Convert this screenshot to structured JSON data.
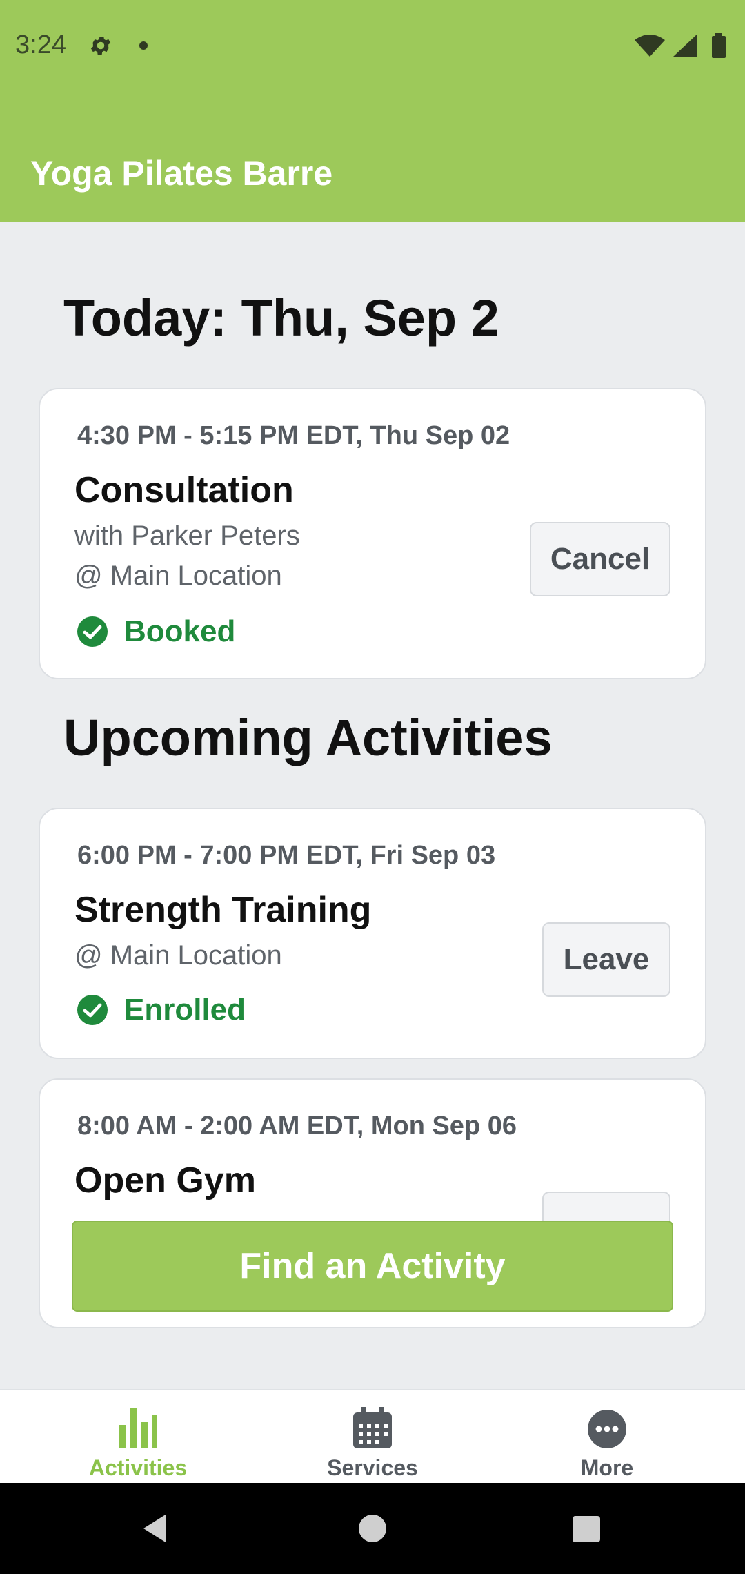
{
  "status_bar": {
    "time": "3:24"
  },
  "header": {
    "title": "Yoga Pilates Barre"
  },
  "today": {
    "heading": "Today: Thu, Sep 2",
    "card": {
      "time": "4:30 PM - 5:15 PM EDT, Thu Sep 02",
      "name": "Consultation",
      "instructor": "with Parker Peters",
      "location": "@ Main Location",
      "status": "Booked",
      "action": "Cancel"
    }
  },
  "upcoming": {
    "heading": "Upcoming Activities",
    "items": [
      {
        "time": "6:00 PM - 7:00 PM EDT, Fri Sep 03",
        "name": "Strength Training",
        "location": "@ Main Location",
        "status": "Enrolled",
        "action": "Leave"
      },
      {
        "time": "8:00 AM - 2:00 AM EDT, Mon Sep 06",
        "name": "Open Gym"
      }
    ]
  },
  "find_button": "Find an Activity",
  "bottom_nav": [
    {
      "label": "Activities",
      "icon": "bar-chart-icon",
      "active": true
    },
    {
      "label": "Services",
      "icon": "calendar-icon",
      "active": false
    },
    {
      "label": "More",
      "icon": "more-icon",
      "active": false
    }
  ],
  "colors": {
    "brand": "#9dc95a",
    "status_green": "#1f8a3c",
    "background": "#ebedef"
  }
}
